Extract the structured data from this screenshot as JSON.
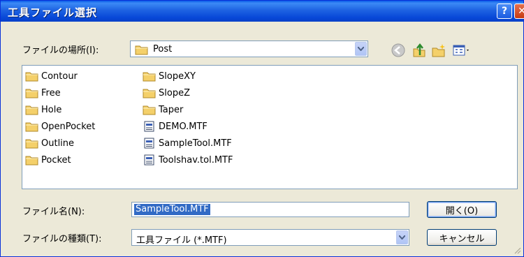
{
  "window": {
    "title": "工具ファイル選択",
    "help_symbol": "?",
    "close_symbol": "✕"
  },
  "location": {
    "label": "ファイルの場所(I):",
    "value": "Post",
    "icon": "folder-icon"
  },
  "toolbar": {
    "buttons": [
      {
        "name": "back-icon"
      },
      {
        "name": "up-folder-icon"
      },
      {
        "name": "new-folder-icon"
      },
      {
        "name": "view-menu-icon"
      }
    ]
  },
  "files": {
    "column1": [
      {
        "label": "Contour",
        "icon": "folder-icon"
      },
      {
        "label": "Free",
        "icon": "folder-icon"
      },
      {
        "label": "Hole",
        "icon": "folder-icon"
      },
      {
        "label": "OpenPocket",
        "icon": "folder-icon"
      },
      {
        "label": "Outline",
        "icon": "folder-icon"
      },
      {
        "label": "Pocket",
        "icon": "folder-icon"
      }
    ],
    "column2": [
      {
        "label": "SlopeXY",
        "icon": "folder-icon"
      },
      {
        "label": "SlopeZ",
        "icon": "folder-icon"
      },
      {
        "label": "Taper",
        "icon": "folder-icon"
      },
      {
        "label": "DEMO.MTF",
        "icon": "file-icon"
      },
      {
        "label": "SampleTool.MTF",
        "icon": "file-icon"
      },
      {
        "label": "Toolshav.tol.MTF",
        "icon": "file-icon"
      }
    ]
  },
  "filename": {
    "label": "ファイル名(N):",
    "value": "SampleTool.MTF"
  },
  "filetype": {
    "label": "ファイルの種類(T):",
    "value": "工具ファイル (*.MTF)"
  },
  "buttons": {
    "open": "開く(O)",
    "cancel": "キャンセル"
  },
  "colors": {
    "titlebar": "#0A5BE8",
    "dialog_bg": "#ECE9D8",
    "selection": "#316AC5",
    "folder": "#F4D06A"
  }
}
